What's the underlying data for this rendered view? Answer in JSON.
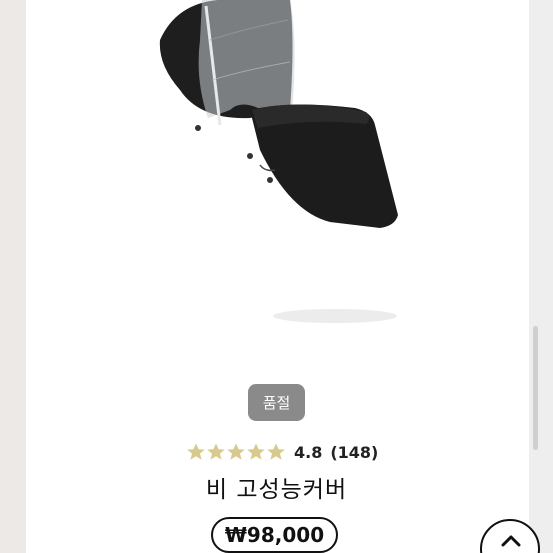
{
  "badge": {
    "label": "품절"
  },
  "rating": {
    "stars": 5,
    "value": "4.8",
    "count": "(148)",
    "star_color": "#d8c98f"
  },
  "product": {
    "name": "비 고성능커버",
    "price": "₩98,000"
  },
  "image": {
    "description_icon": "stroller-bassinet-cover-image"
  },
  "colors": {
    "badge_bg": "#8a8a8a",
    "cover_black": "#1c1c1c"
  }
}
